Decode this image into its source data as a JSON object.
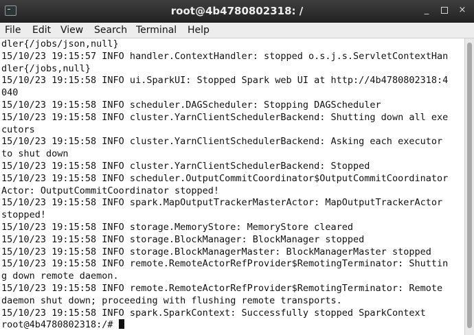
{
  "window": {
    "title": "root@4b4780802318: /",
    "controls": {
      "minimize": "_",
      "maximize": "",
      "close": "×"
    }
  },
  "menu": [
    "File",
    "Edit",
    "View",
    "Search",
    "Terminal",
    "Help"
  ],
  "terminal": {
    "lines": [
      "dler{/jobs/json,null}",
      "15/10/23 19:15:57 INFO handler.ContextHandler: stopped o.s.j.s.ServletContextHan",
      "dler{/jobs,null}",
      "15/10/23 19:15:58 INFO ui.SparkUI: Stopped Spark web UI at http://4b4780802318:4",
      "040",
      "15/10/23 19:15:58 INFO scheduler.DAGScheduler: Stopping DAGScheduler",
      "15/10/23 19:15:58 INFO cluster.YarnClientSchedulerBackend: Shutting down all exe",
      "cutors",
      "15/10/23 19:15:58 INFO cluster.YarnClientSchedulerBackend: Asking each executor",
      "to shut down",
      "15/10/23 19:15:58 INFO cluster.YarnClientSchedulerBackend: Stopped",
      "15/10/23 19:15:58 INFO scheduler.OutputCommitCoordinator$OutputCommitCoordinator",
      "Actor: OutputCommitCoordinator stopped!",
      "15/10/23 19:15:58 INFO spark.MapOutputTrackerMasterActor: MapOutputTrackerActor",
      "stopped!",
      "15/10/23 19:15:58 INFO storage.MemoryStore: MemoryStore cleared",
      "15/10/23 19:15:58 INFO storage.BlockManager: BlockManager stopped",
      "15/10/23 19:15:58 INFO storage.BlockManagerMaster: BlockManagerMaster stopped",
      "15/10/23 19:15:58 INFO remote.RemoteActorRefProvider$RemotingTerminator: Shuttin",
      "g down remote daemon.",
      "15/10/23 19:15:58 INFO remote.RemoteActorRefProvider$RemotingTerminator: Remote",
      "daemon shut down; proceeding with flushing remote transports.",
      "15/10/23 19:15:58 INFO spark.SparkContext: Successfully stopped SparkContext"
    ],
    "prompt": "root@4b4780802318:/# "
  }
}
